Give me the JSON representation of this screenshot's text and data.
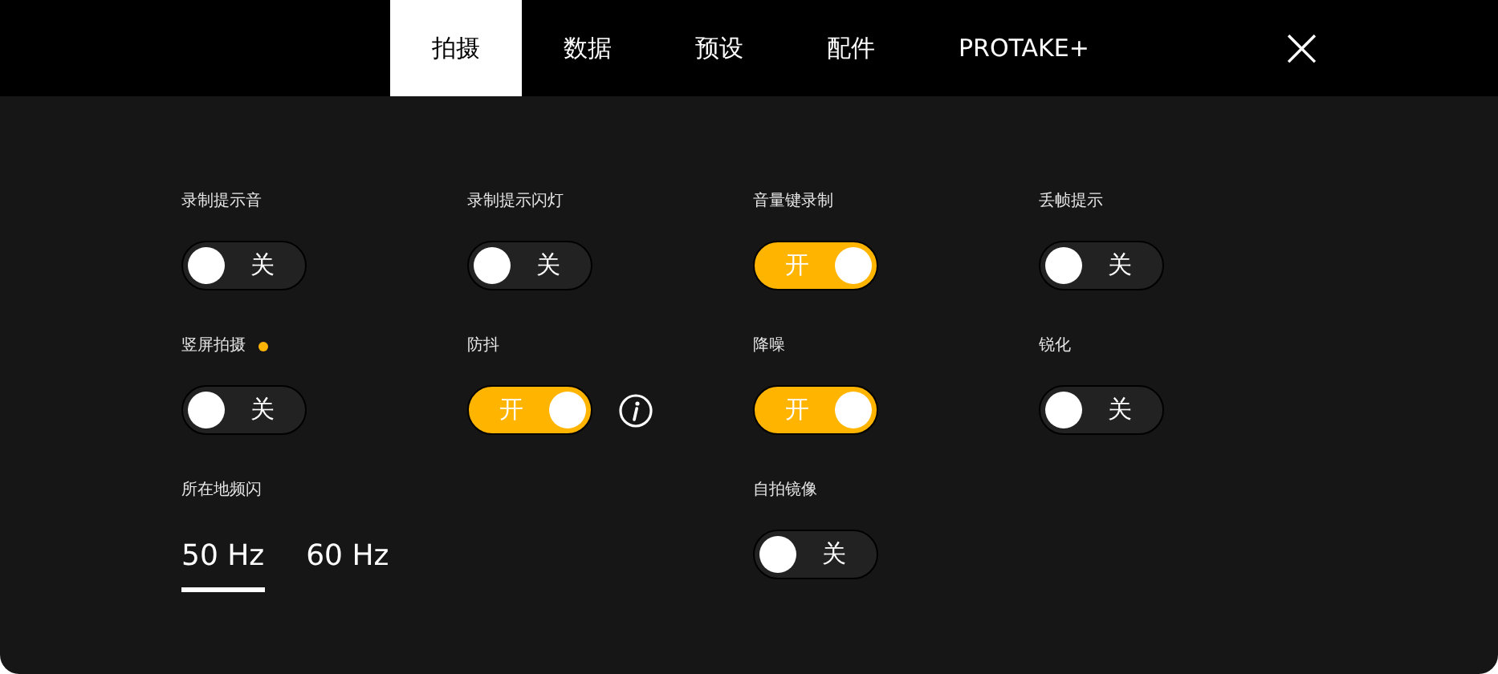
{
  "tabs": [
    {
      "label": "拍摄",
      "selected": true
    },
    {
      "label": "数据",
      "selected": false
    },
    {
      "label": "预设",
      "selected": false
    },
    {
      "label": "配件",
      "selected": false
    },
    {
      "label": "PROTAKE+",
      "selected": false
    }
  ],
  "close": {
    "label": "×"
  },
  "settings": [
    {
      "kind": "toggle",
      "label": "录制提示音",
      "on": false,
      "state_label": "关"
    },
    {
      "kind": "toggle",
      "label": "录制提示闪灯",
      "on": false,
      "state_label": "关"
    },
    {
      "kind": "toggle",
      "label": "音量键录制",
      "on": true,
      "state_label": "开"
    },
    {
      "kind": "toggle",
      "label": "丢帧提示",
      "on": false,
      "state_label": "关"
    },
    {
      "kind": "toggle",
      "label": "竖屏拍摄",
      "on": false,
      "state_label": "关",
      "dot": true
    },
    {
      "kind": "toggle",
      "label": "防抖",
      "on": true,
      "state_label": "开",
      "info": true
    },
    {
      "kind": "toggle",
      "label": "降噪",
      "on": true,
      "state_label": "开"
    },
    {
      "kind": "toggle",
      "label": "锐化",
      "on": false,
      "state_label": "关"
    },
    {
      "kind": "choice",
      "label": "所在地频闪",
      "options": [
        {
          "label": "50 Hz",
          "selected": true
        },
        {
          "label": "60 Hz",
          "selected": false
        }
      ]
    },
    {
      "kind": "toggle",
      "label": "自拍镜像",
      "on": false,
      "state_label": "关"
    }
  ]
}
